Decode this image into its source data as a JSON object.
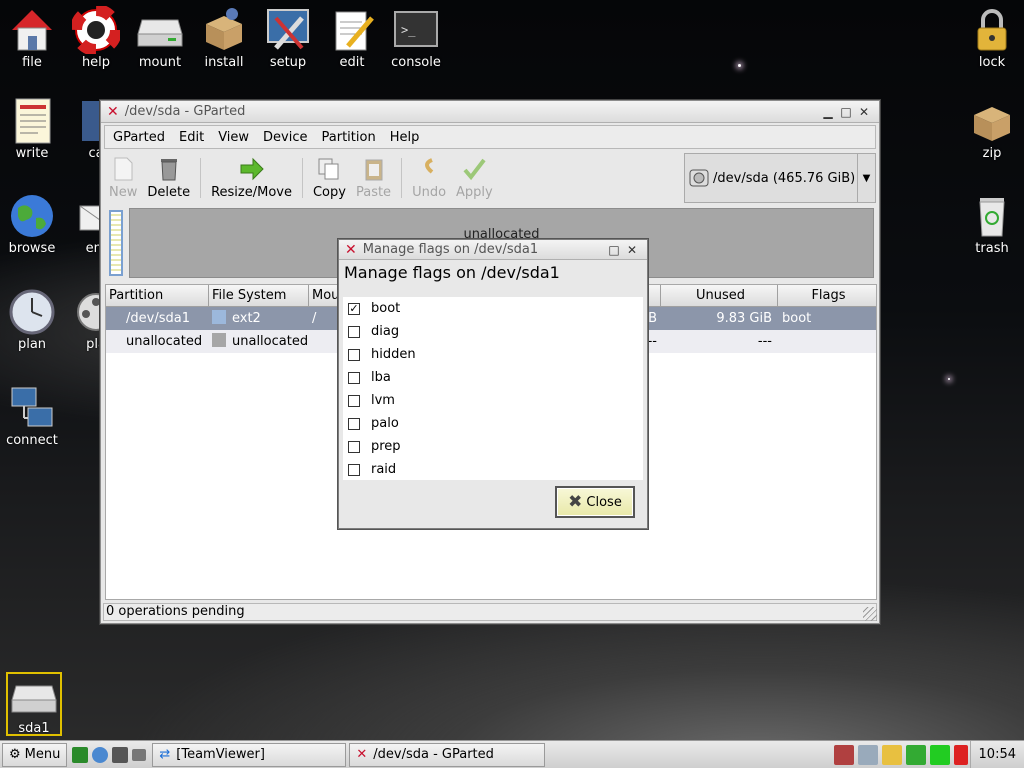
{
  "desktop_icons": [
    {
      "label": "file",
      "icon": "house-icon"
    },
    {
      "label": "help",
      "icon": "lifebuoy-icon"
    },
    {
      "label": "mount",
      "icon": "drive-icon"
    },
    {
      "label": "install",
      "icon": "box-icon"
    },
    {
      "label": "setup",
      "icon": "tools-icon"
    },
    {
      "label": "edit",
      "icon": "notepad-icon"
    },
    {
      "label": "console",
      "icon": "terminal-icon"
    },
    {
      "label": "lock",
      "icon": "padlock-icon"
    },
    {
      "label": "write",
      "icon": "document-icon"
    },
    {
      "label": "ca",
      "icon": "calendar-icon"
    },
    {
      "label": "zip",
      "icon": "box-icon"
    },
    {
      "label": "browse",
      "icon": "globe-icon"
    },
    {
      "label": "em",
      "icon": "envelope-icon"
    },
    {
      "label": "trash",
      "icon": "trash-icon"
    },
    {
      "label": "plan",
      "icon": "clock-icon"
    },
    {
      "label": "pla",
      "icon": "film-icon"
    },
    {
      "label": "connect",
      "icon": "network-icon"
    },
    {
      "label": "sda1",
      "icon": "drive-icon"
    }
  ],
  "window": {
    "title": "/dev/sda - GParted",
    "menu": [
      "GParted",
      "Edit",
      "View",
      "Device",
      "Partition",
      "Help"
    ],
    "toolbar": {
      "new": "New",
      "delete": "Delete",
      "resize": "Resize/Move",
      "copy": "Copy",
      "paste": "Paste",
      "undo": "Undo",
      "apply": "Apply"
    },
    "device": "/dev/sda  (465.76 GiB)",
    "graph_label": "unallocated",
    "columns": {
      "partition": "Partition",
      "filesystem": "File System",
      "mount": "Mou",
      "size": "",
      "used": "",
      "unused": "Unused",
      "flags": "Flags"
    },
    "rows": [
      {
        "partition": "/dev/sda1",
        "filesystem": "ext2",
        "fs_color": "#9cb8dc",
        "mount": "/",
        "used": "B",
        "unused": "9.83 GiB",
        "flags": "boot"
      },
      {
        "partition": "unallocated",
        "filesystem": "unallocated",
        "fs_color": "#a6a6a6",
        "mount": "",
        "used": "---",
        "unused": "---",
        "flags": ""
      }
    ],
    "status": "0 operations pending"
  },
  "dialog": {
    "title": "Manage flags on /dev/sda1",
    "heading": "Manage flags on /dev/sda1",
    "flags": [
      {
        "name": "boot",
        "checked": "✓"
      },
      {
        "name": "diag",
        "checked": ""
      },
      {
        "name": "hidden",
        "checked": ""
      },
      {
        "name": "lba",
        "checked": ""
      },
      {
        "name": "lvm",
        "checked": ""
      },
      {
        "name": "palo",
        "checked": ""
      },
      {
        "name": "prep",
        "checked": ""
      },
      {
        "name": "raid",
        "checked": ""
      }
    ],
    "close_label": "Close"
  },
  "taskbar": {
    "menu_label": "Menu",
    "tasks": [
      "[TeamViewer]",
      "/dev/sda - GParted"
    ],
    "clock": "10:54"
  },
  "colors": {
    "selected_row": "#8c96aa",
    "x_logo": "#c8102e",
    "close_button": "#e8e8a8"
  }
}
